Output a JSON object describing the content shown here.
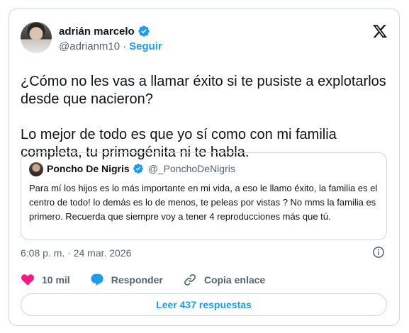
{
  "author": {
    "display_name": "adrián marcelo",
    "handle": "@adrianm10",
    "separator": "·",
    "follow_label": "Seguir"
  },
  "tweet": {
    "text": "¿Cómo no les vas a llamar éxito si te pusiste a explotarlos desde que nacieron?\n\nLo mejor de todo es que yo sí como con mi familia completa, tu primogénita ni te habla."
  },
  "quote": {
    "display_name": "Poncho De Nigris",
    "handle": "@_PonchoDeNigris",
    "text": "Para mí los hijos es lo más importante en mi vida, a eso le llamo éxito, la familia es el centro de todo! lo demás es lo de menos, te peleas por vistas ? No mms la familia es primero. Recuerda que siempre voy a tener 4 reproducciones más que tú."
  },
  "timestamp": "6:08 p. m. · 24 mar. 2026",
  "actions": {
    "likes": "10 mil",
    "reply_label": "Responder",
    "copy_link_label": "Copia enlace"
  },
  "read_replies_label": "Leer 437 respuestas",
  "icons": {
    "brand": "x-logo-icon",
    "verified": "verified-badge-icon",
    "like": "heart-icon",
    "reply": "speech-bubble-icon",
    "copy": "link-icon",
    "info": "info-icon"
  },
  "colors": {
    "accent": "#1d9bf0",
    "like": "#f91880",
    "text": "#0f1419",
    "muted": "#536471",
    "border": "#cfd9de"
  }
}
